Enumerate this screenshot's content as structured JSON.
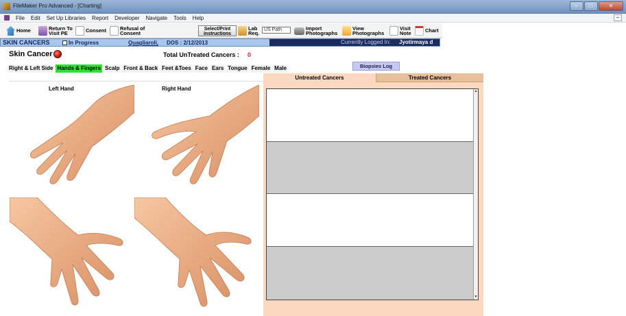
{
  "window": {
    "title": "FileMaker Pro Advanced - [Charting]"
  },
  "menu": [
    "File",
    "Edit",
    "Set Up Libraries",
    "Report",
    "Developer",
    "Navigate",
    "Tools",
    "Help"
  ],
  "toolbar": {
    "home": "Home",
    "return_line1": "Return To",
    "return_line2": "Visit PE",
    "consent": "Consent",
    "refusal_line1": "Refusal of",
    "refusal_line2": "Consent",
    "select_line1": "Select/Print",
    "select_line2": "instructions",
    "lab_line1": "Lab",
    "lab_line2": "Req.",
    "lab_field_value": "US Path",
    "import_line1": "Import",
    "import_line2": "Photographs",
    "view_line1": "View",
    "view_line2": "Photographs",
    "visit_line1": "Visit",
    "visit_line2": "Note",
    "chart": "Chart"
  },
  "info": {
    "section": "SKIN CANCERS",
    "in_progress": "In Progress",
    "doctor": "Quagliaroli,",
    "dos": "DOS : 2/12/2013",
    "currently_logged": "Currently Logged In:",
    "user": "Jyotirmaya d"
  },
  "header": {
    "title": "Skin Cancer",
    "total_label": "Total UnTreated Cancers :",
    "total_value": "0"
  },
  "tabs": [
    "Right & Left Side",
    "Hands & Fingers",
    "Scalp",
    "Front & Back",
    "Feet &Toes",
    "Face",
    "Ears",
    "Tongue",
    "Female",
    "Male"
  ],
  "active_tab": "Hands & Fingers",
  "biopsies_log": "Biopsies Log",
  "hands": {
    "left": "Left Hand",
    "right": "Right Hand"
  },
  "panel": {
    "untreated": "Untreated Cancers",
    "treated": "Treated Cancers"
  },
  "colors": {
    "active_tab": "#2fe12f",
    "panel_bg": "#fbd8c0",
    "info_bar": "#a8c7ea",
    "alert": "#e0251b"
  }
}
